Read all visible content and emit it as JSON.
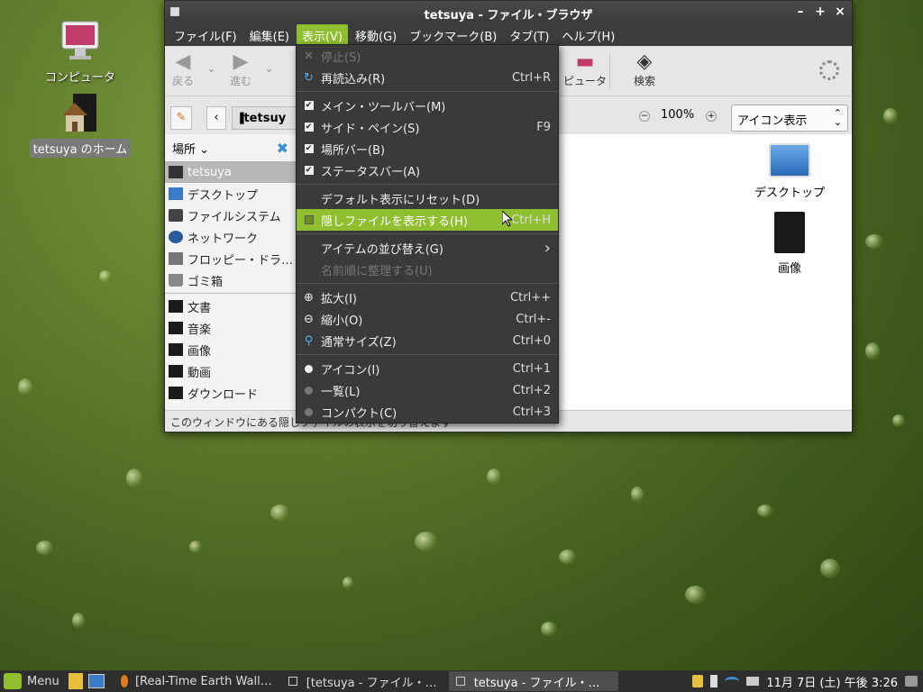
{
  "desktop": {
    "icons": [
      {
        "label": "コンピュータ"
      },
      {
        "label": "tetsuya のホーム"
      }
    ]
  },
  "window": {
    "title": "tetsuya - ファイル・ブラウザ",
    "controls": {
      "minimize": "–",
      "maximize": "+",
      "close": "×"
    },
    "menubar": [
      "ファイル(F)",
      "編集(E)",
      "表示(V)",
      "移動(G)",
      "ブックマーク(B)",
      "タブ(T)",
      "ヘルプ(H)"
    ],
    "toolbar": {
      "back": "戻る",
      "forward": "進む",
      "computer": "ピュータ",
      "search": "検索"
    },
    "location": {
      "path": "tetsuy",
      "zoom": "100%",
      "view_mode": "アイコン表示"
    },
    "sidebar": {
      "header": "場所",
      "places": [
        "tetsuya",
        "デスクトップ",
        "ファイルシステム",
        "ネットワーク",
        "フロッピー・ドラ…",
        "ゴミ箱"
      ],
      "bookmarks": [
        "文書",
        "音楽",
        "画像",
        "動画",
        "ダウンロード"
      ]
    },
    "content_items": [
      "デスクトップ",
      "画像"
    ],
    "statusbar": "このウィンドウにある隠しファイルの表示を切り替えます"
  },
  "menu": {
    "items": [
      {
        "label": "停止(S)",
        "accel": "",
        "disabled": true
      },
      {
        "label": "再読込み(R)",
        "accel": "Ctrl+R"
      },
      {
        "label": "メイン・ツールバー(M)",
        "accel": ""
      },
      {
        "label": "サイド・ペイン(S)",
        "accel": "F9"
      },
      {
        "label": "場所バー(B)",
        "accel": ""
      },
      {
        "label": "ステータスバー(A)",
        "accel": ""
      },
      {
        "label": "デフォルト表示にリセット(D)",
        "accel": ""
      },
      {
        "label": "隠しファイルを表示する(H)",
        "accel": "Ctrl+H"
      },
      {
        "label": "アイテムの並び替え(G)",
        "accel": "›"
      },
      {
        "label": "名前順に整理する(U)",
        "accel": "",
        "disabled": true
      },
      {
        "label": "拡大(I)",
        "accel": "Ctrl++"
      },
      {
        "label": "縮小(O)",
        "accel": "Ctrl+-"
      },
      {
        "label": "通常サイズ(Z)",
        "accel": "Ctrl+0"
      },
      {
        "label": "アイコン(I)",
        "accel": "Ctrl+1"
      },
      {
        "label": "一覧(L)",
        "accel": "Ctrl+2"
      },
      {
        "label": "コンパクト(C)",
        "accel": "Ctrl+3"
      }
    ]
  },
  "taskbar": {
    "menu_label": "Menu",
    "tasks": [
      "[Real-Time Earth Wall…",
      "[tetsuya - ファイル・…",
      "tetsuya - ファイル・…"
    ],
    "clock": "11月 7日 (土) 午後 3:26"
  }
}
